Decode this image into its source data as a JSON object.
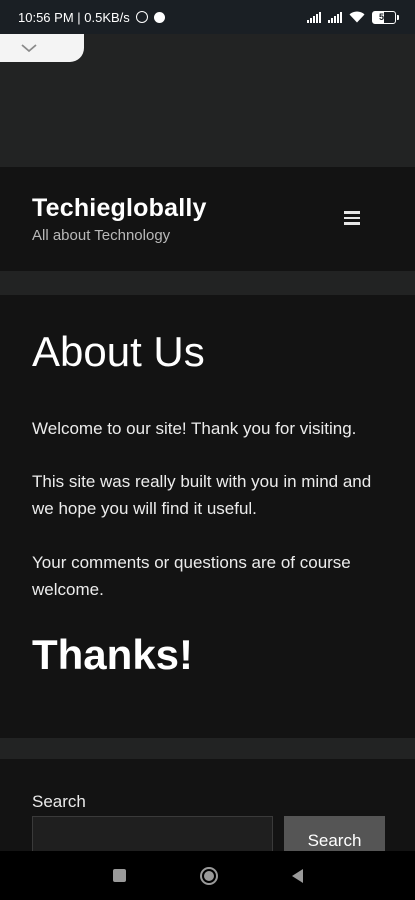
{
  "status_bar": {
    "time_speed": "10:56 PM | 0.5KB/s",
    "battery": "53"
  },
  "header": {
    "site_title": "Techieglobally",
    "tagline": "All about Technology",
    "menu_icon": "hamburger-icon"
  },
  "page": {
    "title": "About Us",
    "paragraphs": [
      "Welcome to our site! Thank you for visiting.",
      "This site was really built with you in mind and we hope you will find it useful.",
      "Your comments or questions are of course welcome."
    ],
    "closing": "Thanks!"
  },
  "search_widget": {
    "label": "Search",
    "input_value": "",
    "button_label": "Search"
  },
  "nav_bar": {
    "icons": [
      "recents-square-icon",
      "home-circle-icon",
      "back-triangle-icon"
    ]
  },
  "colors": {
    "page_bg": "#222323",
    "panel_bg": "#131313",
    "button_bg": "#555555",
    "text": "#ffffff"
  }
}
